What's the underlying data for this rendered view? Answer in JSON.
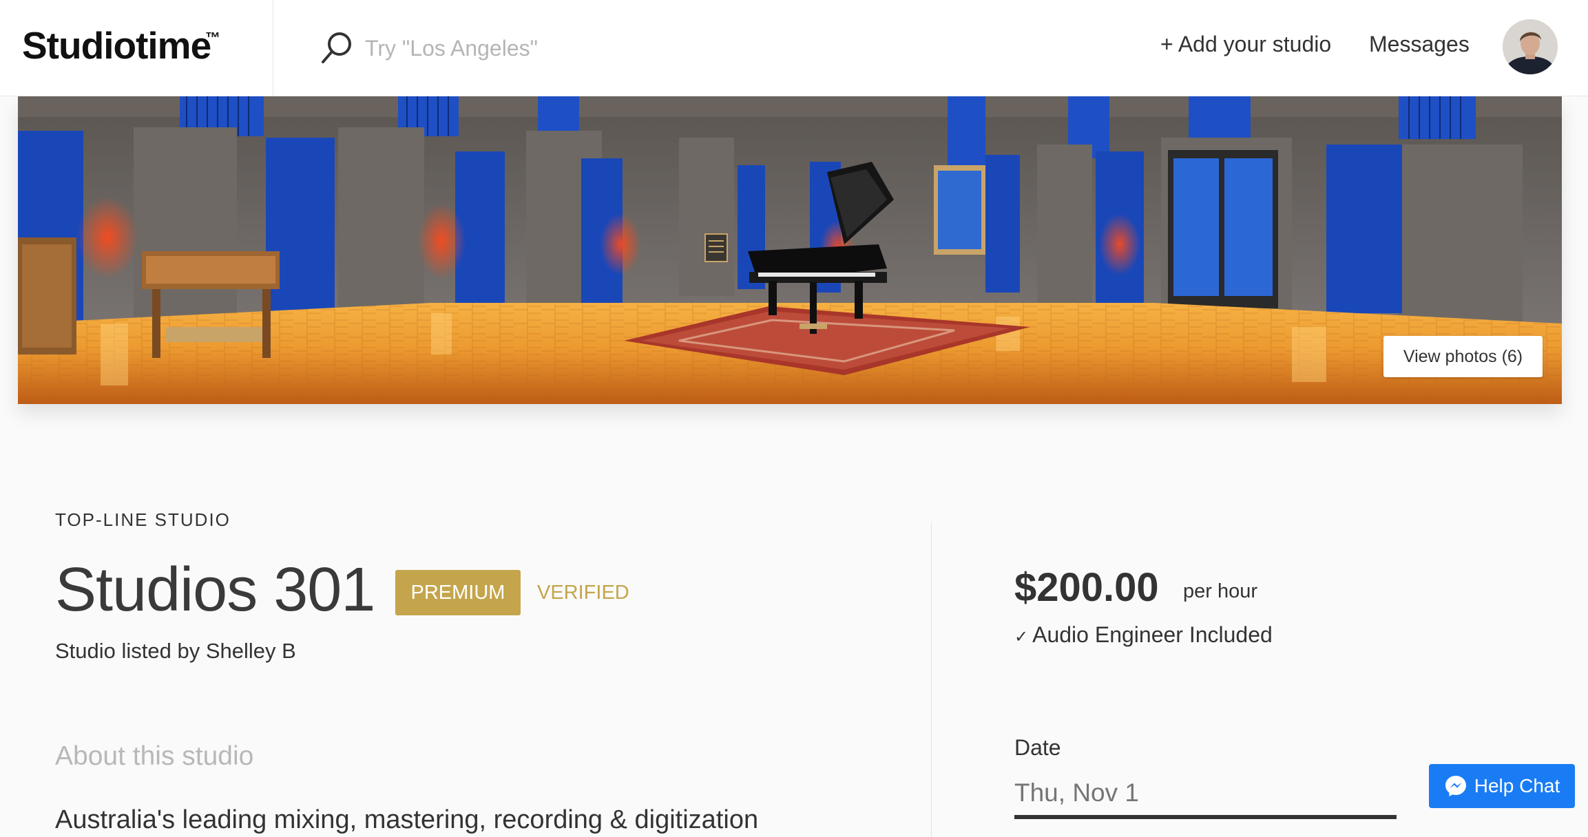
{
  "header": {
    "brand": "Studiotime",
    "brand_tm": "™",
    "search_placeholder": "Try \"Los Angeles\"",
    "add_studio_label": "+ Add your studio",
    "messages_label": "Messages"
  },
  "hero": {
    "view_photos_label": "View photos (6)"
  },
  "listing": {
    "eyebrow": "TOP-LINE STUDIO",
    "title": "Studios 301",
    "premium_badge": "PREMIUM",
    "verified_badge": "VERIFIED",
    "listed_by": "Studio listed by Shelley B",
    "about_heading": "About this studio",
    "about_text": "Australia's leading mixing, mastering, recording & digitization"
  },
  "booking": {
    "price": "$200.00",
    "price_unit": "per hour",
    "engineer_check": "✓",
    "engineer_label": "Audio Engineer Included",
    "date_label": "Date",
    "date_placeholder": "Thu, Nov 1"
  },
  "help_chat": {
    "label": "Help Chat"
  },
  "colors": {
    "accent_gold": "#c4a54b",
    "help_blue": "#1a7cf4",
    "panel_blue": "#1a47b8",
    "floor_orange": "#e08a2a"
  }
}
